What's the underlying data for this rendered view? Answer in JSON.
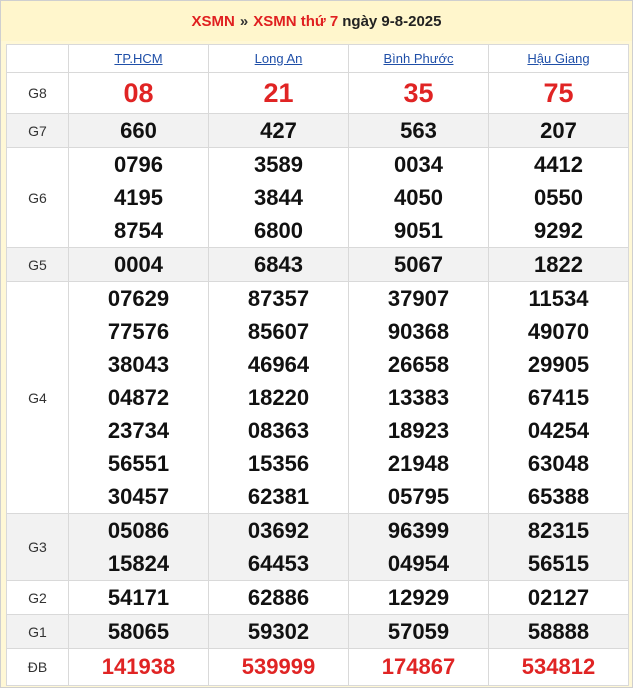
{
  "header": {
    "link1": "XSMN",
    "separator": "»",
    "link2": "XSMN thứ 7",
    "date_text": "ngày 9-8-2025"
  },
  "provinces": [
    "TP.HCM",
    "Long An",
    "Bình Phước",
    "Hậu Giang"
  ],
  "prizes": [
    {
      "label": "G8",
      "values": [
        [
          "08"
        ],
        [
          "21"
        ],
        [
          "35"
        ],
        [
          "75"
        ]
      ]
    },
    {
      "label": "G7",
      "values": [
        [
          "660"
        ],
        [
          "427"
        ],
        [
          "563"
        ],
        [
          "207"
        ]
      ]
    },
    {
      "label": "G6",
      "values": [
        [
          "0796",
          "4195",
          "8754"
        ],
        [
          "3589",
          "3844",
          "6800"
        ],
        [
          "0034",
          "4050",
          "9051"
        ],
        [
          "4412",
          "0550",
          "9292"
        ]
      ]
    },
    {
      "label": "G5",
      "values": [
        [
          "0004"
        ],
        [
          "6843"
        ],
        [
          "5067"
        ],
        [
          "1822"
        ]
      ]
    },
    {
      "label": "G4",
      "values": [
        [
          "07629",
          "77576",
          "38043",
          "04872",
          "23734",
          "56551",
          "30457"
        ],
        [
          "87357",
          "85607",
          "46964",
          "18220",
          "08363",
          "15356",
          "62381"
        ],
        [
          "37907",
          "90368",
          "26658",
          "13383",
          "18923",
          "21948",
          "05795"
        ],
        [
          "11534",
          "49070",
          "29905",
          "67415",
          "04254",
          "63048",
          "65388"
        ]
      ]
    },
    {
      "label": "G3",
      "values": [
        [
          "05086",
          "15824"
        ],
        [
          "03692",
          "64453"
        ],
        [
          "96399",
          "04954"
        ],
        [
          "82315",
          "56515"
        ]
      ]
    },
    {
      "label": "G2",
      "values": [
        [
          "54171"
        ],
        [
          "62886"
        ],
        [
          "12929"
        ],
        [
          "02127"
        ]
      ]
    },
    {
      "label": "G1",
      "values": [
        [
          "58065"
        ],
        [
          "59302"
        ],
        [
          "57059"
        ],
        [
          "58888"
        ]
      ]
    },
    {
      "label": "ĐB",
      "values": [
        [
          "141938"
        ],
        [
          "539999"
        ],
        [
          "174867"
        ],
        [
          "534812"
        ]
      ]
    }
  ],
  "colors": {
    "accent_red": "#e02424",
    "link_blue": "#1f4fa8",
    "header_bg": "#fff6cc",
    "alt_row_bg": "#f2f2f2"
  }
}
